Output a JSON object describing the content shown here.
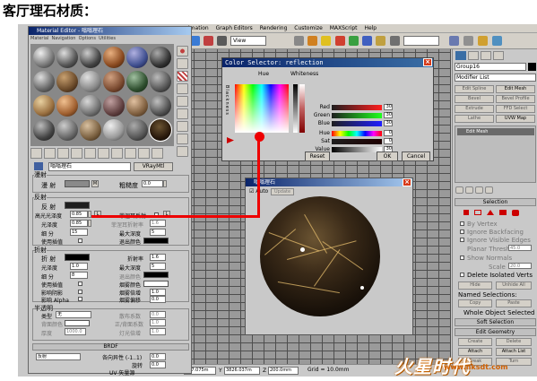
{
  "heading": "客厅理石材质：",
  "max_window": {
    "menu": [
      "imation",
      "Graph Editors",
      "Rendering",
      "Customize",
      "MAXScript",
      "Help"
    ],
    "view_select": "View",
    "status": {
      "x": "007.075m",
      "y": "3826.037m",
      "z": "200.0mm",
      "grid": "Grid = 10.0mm"
    }
  },
  "command_panel": {
    "object_name": "Group16",
    "modifier_list": "Modifier List",
    "buttons": [
      "Edit Spline",
      "Edit Mesh",
      "Bevel",
      "Bevel Profile",
      "Extrude",
      "FFD Select",
      "Lathe",
      "UVW Map"
    ],
    "stack_item": "Edit Mesh",
    "selection_rollout": "Selection",
    "options": [
      "By Vertex",
      "Ignore Backfacing",
      "Ignore Visible Edges",
      "Planar Thresh",
      "Show Normals",
      "Scale",
      "Delete Isolated Verts"
    ],
    "planar_thresh": "45.0",
    "scale": "20.0",
    "hide": "Hide",
    "unhide_all": "Unhide All",
    "named_selections": "Named Selections:",
    "copy": "Copy",
    "paste": "Paste",
    "whole_object": "Whole Object Selected",
    "soft_selection": "Soft Selection",
    "edit_geometry": "Edit Geometry",
    "create": "Create",
    "delete": "Delete",
    "attach": "Attach",
    "attach_list": "Attach List",
    "break": "Break",
    "turn": "Turn"
  },
  "material_editor": {
    "title": "Material Editor - 嗡嗡理石",
    "menu": [
      "Material",
      "Navigation",
      "Options",
      "Utilities"
    ],
    "material_name": "嗡嗡理石",
    "material_type": "VRayMtl",
    "diffuse_group": "漫射",
    "diffuse_label": "漫 射",
    "diffuse_map": "M",
    "roughness_label": "粗糙度",
    "roughness": "0.0",
    "reflect_group": "反射",
    "reflect_label": "反 射",
    "hilight_gloss_label": "高光光泽度",
    "hilight_gloss": "0.85",
    "hilight_lock": "L",
    "fresnel_label": "菲涅耳反射",
    "refl_gloss_label": "光泽度",
    "refl_gloss": "0.85",
    "fresnel_ior_label": "菲涅耳折射率",
    "fresnel_ior": "1.6",
    "subdivs_label": "细 分",
    "subdivs": "15",
    "max_depth_label": "最大深度",
    "max_depth": "5",
    "use_interp_label": "使用插值",
    "exit_color_label": "退出颜色",
    "refract_group": "折射",
    "refract_label": "折 射",
    "ior_label": "折射率",
    "ior": "1.6",
    "refr_gloss_label": "光泽度",
    "refr_gloss": "1.0",
    "refr_max_depth_label": "最大深度",
    "refr_max_depth": "5",
    "refr_subdivs_label": "细 分",
    "refr_subdivs": "8",
    "refr_exit_label": "退出颜色",
    "refr_interp_label": "使用插值",
    "fog_color_label": "烟雾颜色",
    "shadows_label": "影响阴影",
    "fog_mult_label": "烟雾倍增",
    "fog_mult": "1.0",
    "affect_alpha_label": "影响 Alpha",
    "fog_bias_label": "烟雾偏移",
    "fog_bias": "0.0",
    "translucency_group": "半透明",
    "type_label": "类型",
    "type_value": "无",
    "back_color_label": "背面颜色",
    "thickness_label": "厚度",
    "thickness": "1000.0",
    "scatter_label": "散布系数",
    "scatter": "0.0",
    "fwd_back_label": "正/背面系数",
    "fwd_back": "1.0",
    "light_mult_label": "灯光倍增",
    "light_mult": "1.0",
    "brdf_rollout": "BRDF",
    "brdf_type": "反射",
    "anisotropy_label": "各向异性 (-1..1)",
    "anisotropy": "0.0",
    "rotation_label": "旋转",
    "rotation": "0.0",
    "uv_label": "UV 矢量源"
  },
  "color_selector": {
    "title": "Color Selector: reflection",
    "hue_label": "Hue",
    "whiteness_label": "Whiteness",
    "blackness_label": "Blackness",
    "channels": [
      {
        "label": "Red",
        "value": "30"
      },
      {
        "label": "Green",
        "value": "30"
      },
      {
        "label": "Blue",
        "value": "30"
      },
      {
        "label": "Hue",
        "value": "0"
      },
      {
        "label": "Sat",
        "value": "0"
      },
      {
        "label": "Value",
        "value": "30"
      }
    ],
    "reset": "Reset",
    "ok": "OK",
    "cancel": "Cancel"
  },
  "preview": {
    "title": "嗡嗡理石",
    "auto": "Auto",
    "update": "Update"
  },
  "watermark": {
    "text": "火星时代",
    "url": "www.nksdt.com"
  },
  "colors": {
    "reflection_swatch": "#1e1e1e",
    "diffuse_swatch": "#8a8a8a",
    "indicator_red": "#e00000",
    "titlebar": "#0a246a"
  }
}
